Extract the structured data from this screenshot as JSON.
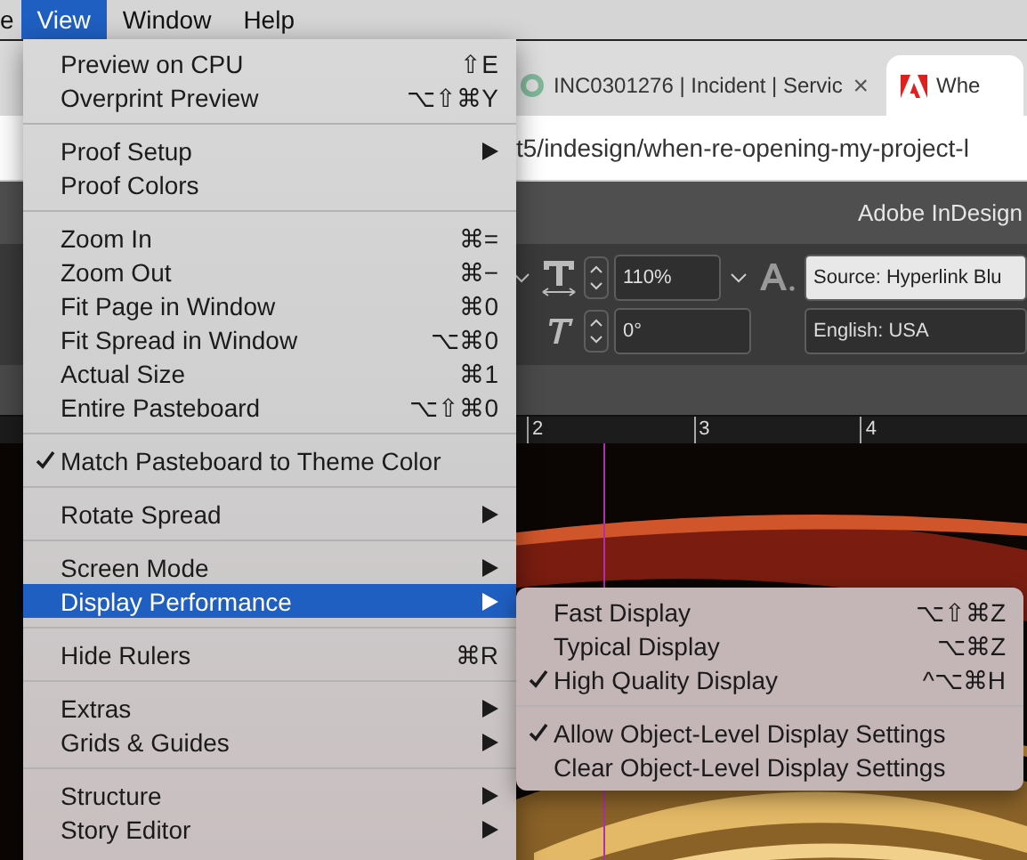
{
  "menu_bar": [
    {
      "label": "e",
      "selected": false
    },
    {
      "label": "View",
      "selected": true
    },
    {
      "label": "Window",
      "selected": false
    },
    {
      "label": "Help",
      "selected": false
    }
  ],
  "browser": {
    "tabs": [
      {
        "label": "INC0301276 | Incident | Servic",
        "selected": false,
        "close": "×"
      },
      {
        "label": "Whe",
        "selected": true
      }
    ],
    "url": "t5/indesign/when-re-opening-my-project-l"
  },
  "app": {
    "title": "Adobe InDesign",
    "scale": "110%",
    "skew": "0°",
    "character_style": "Source: Hyperlink Blu",
    "language": "English: USA",
    "ruler": [
      "2",
      "3",
      "4"
    ]
  },
  "view_menu": [
    [
      {
        "label": "Preview on CPU",
        "shortcut": "⇧E",
        "submenu": false,
        "checked": false,
        "selected": false
      },
      {
        "label": "Overprint Preview",
        "shortcut": "⌥⇧⌘Y",
        "submenu": false,
        "checked": false,
        "selected": false
      }
    ],
    [
      {
        "label": "Proof Setup",
        "submenu": true,
        "checked": false,
        "selected": false
      },
      {
        "label": "Proof Colors",
        "submenu": false,
        "checked": false,
        "selected": false
      }
    ],
    [
      {
        "label": "Zoom In",
        "shortcut": "⌘=",
        "submenu": false,
        "checked": false,
        "selected": false
      },
      {
        "label": "Zoom Out",
        "shortcut": "⌘−",
        "submenu": false,
        "checked": false,
        "selected": false
      },
      {
        "label": "Fit Page in Window",
        "shortcut": "⌘0",
        "submenu": false,
        "checked": false,
        "selected": false
      },
      {
        "label": "Fit Spread in Window",
        "shortcut": "⌥⌘0",
        "submenu": false,
        "checked": false,
        "selected": false
      },
      {
        "label": "Actual Size",
        "shortcut": "⌘1",
        "submenu": false,
        "checked": false,
        "selected": false
      },
      {
        "label": "Entire Pasteboard",
        "shortcut": "⌥⇧⌘0",
        "submenu": false,
        "checked": false,
        "selected": false
      }
    ],
    [
      {
        "label": "Match Pasteboard to Theme Color",
        "submenu": false,
        "checked": true,
        "selected": false
      }
    ],
    [
      {
        "label": "Rotate Spread",
        "submenu": true,
        "checked": false,
        "selected": false
      }
    ],
    [
      {
        "label": "Screen Mode",
        "submenu": true,
        "checked": false,
        "selected": false
      },
      {
        "label": "Display Performance",
        "submenu": true,
        "checked": false,
        "selected": true
      }
    ],
    [
      {
        "label": "Hide Rulers",
        "shortcut": "⌘R",
        "submenu": false,
        "checked": false,
        "selected": false
      }
    ],
    [
      {
        "label": "Extras",
        "submenu": true,
        "checked": false,
        "selected": false
      },
      {
        "label": "Grids & Guides",
        "submenu": true,
        "checked": false,
        "selected": false
      }
    ],
    [
      {
        "label": "Structure",
        "submenu": true,
        "checked": false,
        "selected": false
      },
      {
        "label": "Story Editor",
        "submenu": true,
        "checked": false,
        "selected": false
      }
    ]
  ],
  "display_performance_menu": [
    [
      {
        "label": "Fast Display",
        "shortcut": "⌥⇧⌘Z",
        "checked": false
      },
      {
        "label": "Typical Display",
        "shortcut": "⌥⌘Z",
        "checked": false
      },
      {
        "label": "High Quality Display",
        "shortcut": "^⌥⌘H",
        "checked": true
      }
    ],
    [
      {
        "label": "Allow Object-Level Display Settings",
        "checked": true
      },
      {
        "label": "Clear Object-Level Display Settings",
        "checked": false
      }
    ]
  ]
}
